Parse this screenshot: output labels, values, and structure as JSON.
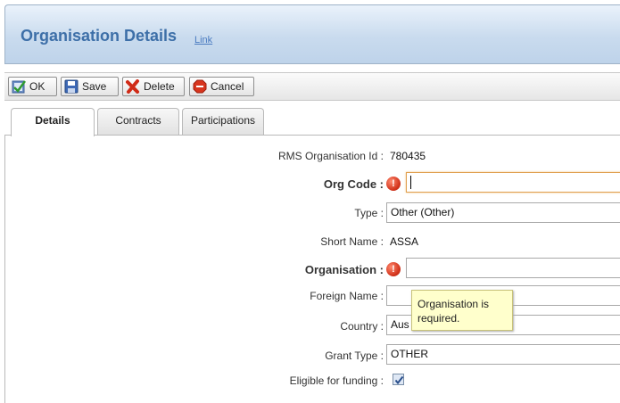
{
  "header": {
    "title": "Organisation Details",
    "link": "Link"
  },
  "toolbar": {
    "ok": "OK",
    "save": "Save",
    "delete": "Delete",
    "cancel": "Cancel"
  },
  "tabs": [
    {
      "label": "Details",
      "active": true
    },
    {
      "label": "Contracts",
      "active": false
    },
    {
      "label": "Participations",
      "active": false
    }
  ],
  "form": {
    "rms_id": {
      "label": "RMS Organisation Id :",
      "value": "780435"
    },
    "org_code": {
      "label": "Org Code :",
      "value": ""
    },
    "type": {
      "label": "Type :",
      "value": "Other (Other)"
    },
    "short_name": {
      "label": "Short Name :",
      "value": "ASSA"
    },
    "organisation": {
      "label": "Organisation :",
      "value": ""
    },
    "foreign_name": {
      "label": "Foreign Name :",
      "value": ""
    },
    "country": {
      "label": "Country :",
      "value": "Aus"
    },
    "grant_type": {
      "label": "Grant Type :",
      "value": "OTHER"
    },
    "eligible": {
      "label": "Eligible for funding :",
      "checked": true
    }
  },
  "tooltip": {
    "line1": "Organisation is",
    "line2": "required."
  },
  "icons": {
    "ok": "ok-check-icon",
    "save": "floppy-disk-icon",
    "delete": "red-x-icon",
    "cancel": "stop-sign-icon",
    "error": "error-icon"
  },
  "colors": {
    "title": "#3d6fa8",
    "error": "#d2331b",
    "tooltip_bg": "#ffffcc",
    "focus_border": "#e0a050"
  }
}
